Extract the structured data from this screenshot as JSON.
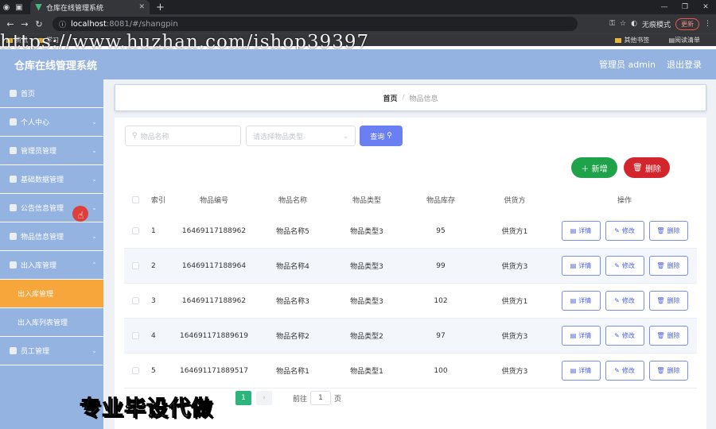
{
  "browser": {
    "tab_title": "仓库在线管理系统",
    "url_host": "localhost",
    "url_path": ":8081/#/shangpin",
    "profile_label": "无痕模式",
    "update_label": "更新",
    "bookmarks": [
      "资讯",
      "学习"
    ],
    "bookmarks_right": [
      "其他书签",
      "阅读清单"
    ]
  },
  "watermark": "https://www.huzhan.com/ishop39397",
  "header": {
    "title": "仓库在线管理系统",
    "admin_label": "管理员 admin",
    "logout_label": "退出登录"
  },
  "sidebar": {
    "items": [
      {
        "label": "首页"
      },
      {
        "label": "个人中心"
      },
      {
        "label": "管理员管理"
      },
      {
        "label": "基础数据管理"
      },
      {
        "label": "公告信息管理"
      },
      {
        "label": "物品信息管理"
      },
      {
        "label": "出入库管理"
      },
      {
        "label": "出入库管理"
      },
      {
        "label": "出入库列表管理"
      },
      {
        "label": "员工管理"
      }
    ]
  },
  "breadcrumb": {
    "home": "首页",
    "separator": "/",
    "current": "物品信息"
  },
  "search": {
    "name_placeholder": "物品名称",
    "type_placeholder": "请选择物品类型",
    "query_label": "查询"
  },
  "actions": {
    "add_label": "新增",
    "delete_label": "删除"
  },
  "table": {
    "headers": {
      "index": "索引",
      "code": "物品编号",
      "name": "物品名称",
      "type": "物品类型",
      "stock": "物品库存",
      "supplier": "供货方",
      "ops": "操作"
    },
    "op_labels": {
      "detail": "详情",
      "edit": "修改",
      "delete": "删除"
    },
    "rows": [
      {
        "index": "1",
        "code": "16469117188962",
        "name": "物品名称5",
        "type": "物品类型3",
        "stock": "95",
        "supplier": "供货方1"
      },
      {
        "index": "2",
        "code": "16469117188964",
        "name": "物品名称4",
        "type": "物品类型3",
        "stock": "99",
        "supplier": "供货方3"
      },
      {
        "index": "3",
        "code": "16469117188962",
        "name": "物品名称3",
        "type": "物品类型3",
        "stock": "102",
        "supplier": "供货方1"
      },
      {
        "index": "4",
        "code": "164691171889619",
        "name": "物品名称2",
        "type": "物品类型2",
        "stock": "97",
        "supplier": "供货方3"
      },
      {
        "index": "5",
        "code": "164691171889517",
        "name": "物品名称1",
        "type": "物品类型1",
        "stock": "100",
        "supplier": "供货方3"
      }
    ]
  },
  "pagination": {
    "current_page": "1",
    "goto_label": "前往",
    "goto_value": "1",
    "page_unit": "页"
  },
  "overlay_text": "专业毕设代做",
  "colors": {
    "header_bg": "#94b3e0",
    "active_menu": "#f6a63a",
    "query_btn": "#6a7ff2",
    "add_btn": "#1ea24a",
    "delete_btn": "#d3262c",
    "page_active": "#2db37c"
  }
}
